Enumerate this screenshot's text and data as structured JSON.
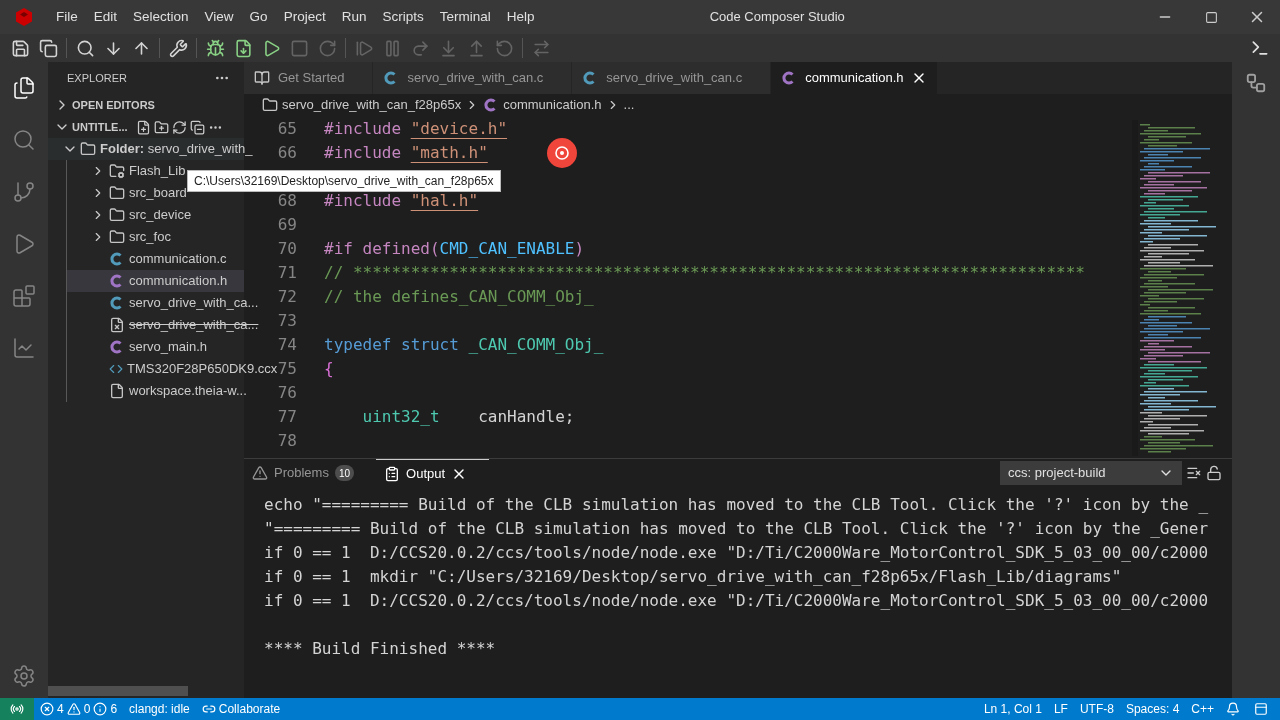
{
  "window": {
    "title": "Code Composer Studio"
  },
  "menu": [
    "File",
    "Edit",
    "Selection",
    "View",
    "Go",
    "Project",
    "Run",
    "Scripts",
    "Terminal",
    "Help"
  ],
  "toolbar": [
    {
      "kind": "save",
      "disabled": false
    },
    {
      "kind": "save-all",
      "disabled": false
    },
    {
      "kind": "sep"
    },
    {
      "kind": "search",
      "disabled": false
    },
    {
      "kind": "down",
      "disabled": false
    },
    {
      "kind": "up",
      "disabled": false
    },
    {
      "kind": "sep"
    },
    {
      "kind": "tools",
      "disabled": false
    },
    {
      "kind": "sep"
    },
    {
      "kind": "debug",
      "disabled": false
    },
    {
      "kind": "flash",
      "disabled": false
    },
    {
      "kind": "debug-run",
      "disabled": false
    },
    {
      "kind": "stop",
      "disabled": true
    },
    {
      "kind": "reload",
      "disabled": true
    },
    {
      "kind": "sep"
    },
    {
      "kind": "resume",
      "disabled": true
    },
    {
      "kind": "pause",
      "disabled": true
    },
    {
      "kind": "step-over",
      "disabled": true
    },
    {
      "kind": "step-into",
      "disabled": true
    },
    {
      "kind": "step-out",
      "disabled": true
    },
    {
      "kind": "restart",
      "disabled": true
    },
    {
      "kind": "sep"
    },
    {
      "kind": "connect",
      "disabled": true
    }
  ],
  "activity_bar": [
    {
      "kind": "explorer",
      "selected": true
    },
    {
      "kind": "search",
      "selected": false
    },
    {
      "kind": "source-control",
      "selected": false
    },
    {
      "kind": "run-debug",
      "selected": false
    },
    {
      "kind": "extensions",
      "selected": false
    },
    {
      "kind": "chart",
      "selected": false
    }
  ],
  "sidebar": {
    "title": "EXPLORER",
    "sections": [
      {
        "label": "OPEN EDITORS",
        "expanded": false
      },
      {
        "label": "UNTITLE...",
        "expanded": true
      }
    ],
    "root": {
      "label": "**Folder:** servo_drive_with_",
      "expanded": true,
      "children": [
        {
          "kind": "folder-gear",
          "label": "Flash_Lib",
          "expanded": false,
          "selected": false,
          "struck": false
        },
        {
          "kind": "folder",
          "label": "src_board",
          "expanded": false,
          "selected": false,
          "struck": false
        },
        {
          "kind": "folder",
          "label": "src_device",
          "expanded": false,
          "selected": false,
          "struck": false
        },
        {
          "kind": "folder",
          "label": "src_foc",
          "expanded": false,
          "selected": false,
          "struck": false
        },
        {
          "kind": "c",
          "label": "communication.c",
          "selected": false,
          "struck": false
        },
        {
          "kind": "h",
          "label": "communication.h",
          "selected": true,
          "struck": false
        },
        {
          "kind": "c",
          "label": "servo_drive_with_ca...",
          "selected": false,
          "struck": false
        },
        {
          "kind": "file-off",
          "label": "servo_drive_with_ca...",
          "selected": false,
          "struck": true
        },
        {
          "kind": "h",
          "label": "servo_main.h",
          "selected": false,
          "struck": false
        },
        {
          "kind": "xml",
          "label": "TMS320F28P650DK9.ccx",
          "selected": false,
          "struck": false
        },
        {
          "kind": "file",
          "label": "workspace.theia-w...",
          "selected": false,
          "struck": false
        }
      ]
    }
  },
  "tooltip": "C:\\Users\\32169\\Desktop\\servo_drive_with_can_f28p65x",
  "editor_tabs": [
    {
      "kind": "book",
      "label": "Get Started",
      "selected": false
    },
    {
      "kind": "c",
      "label": "servo_drive_with_can.c",
      "selected": false
    },
    {
      "kind": "c",
      "label": "servo_drive_with_can.c",
      "selected": false
    },
    {
      "kind": "h",
      "label": "communication.h",
      "selected": true
    }
  ],
  "breadcrumbs": [
    {
      "kind": "folder",
      "label": "servo_drive_with_can_f28p65x"
    },
    {
      "kind": "h",
      "label": "communication.h"
    },
    {
      "kind": "more",
      "label": "..."
    }
  ],
  "code_lines": [
    {
      "number": "65",
      "tokens": [
        {
          "kind": "directive",
          "text": "#include "
        },
        {
          "kind": "path",
          "text": "\"device.h\""
        }
      ]
    },
    {
      "number": "66",
      "tokens": [
        {
          "kind": "directive",
          "text": "#include "
        },
        {
          "kind": "path",
          "text": "\"math.h\""
        }
      ]
    },
    {
      "covered": true
    },
    {
      "number": "68",
      "tokens": [
        {
          "kind": "directive",
          "text": "#include "
        },
        {
          "kind": "path",
          "text": "\"hal.h\""
        }
      ]
    },
    {
      "number": "69"
    },
    {
      "number": "70",
      "tokens": [
        {
          "kind": "directive",
          "text": "#if defined("
        },
        {
          "kind": "macro",
          "text": "CMD_CAN_ENABLE"
        },
        {
          "kind": "directive",
          "text": ")"
        }
      ]
    },
    {
      "number": "71",
      "tokens": [
        {
          "kind": "comment",
          "text": "// ****************************************************************************"
        }
      ]
    },
    {
      "number": "72",
      "tokens": [
        {
          "kind": "comment",
          "text": "// the defines_CAN_COMM_Obj_"
        }
      ]
    },
    {
      "number": "73"
    },
    {
      "number": "74",
      "tokens": [
        {
          "kind": "keyword",
          "text": "typedef struct "
        },
        {
          "kind": "type",
          "text": "_CAN_COMM_Obj_"
        }
      ]
    },
    {
      "number": "75",
      "tokens": [
        {
          "kind": "bracket",
          "text": "{"
        }
      ]
    },
    {
      "number": "76"
    },
    {
      "number": "77",
      "tokens": [
        {
          "kind": "type",
          "text": "    uint32_t"
        },
        {
          "kind": "plain",
          "text": "    canHandle;"
        }
      ]
    },
    {
      "number": "78"
    }
  ],
  "panel": {
    "tabs": [
      {
        "kind": "problems",
        "label": "Problems",
        "badge": "10",
        "selected": false
      },
      {
        "kind": "output",
        "label": "Output",
        "selected": true
      }
    ],
    "channel": "ccs: project-build",
    "output": [
      "echo \"========= Build of the CLB simulation has moved to the CLB Tool. Click the '?' icon by the _",
      "\"========= Build of the CLB simulation has moved to the CLB Tool. Click the '?' icon by the _Gener",
      "if 0 == 1  D:/CCS20.0.2/ccs/tools/node/node.exe \"D:/Ti/C2000Ware_MotorControl_SDK_5_03_00_00/c2000",
      "if 0 == 1  mkdir \"C:/Users/32169/Desktop/servo_drive_with_can_f28p65x/Flash_Lib/diagrams\"",
      "if 0 == 1  D:/CCS20.0.2/ccs/tools/node/node.exe \"D:/Ti/C2000Ware_MotorControl_SDK_5_03_00_00/c2000"
    ],
    "summary": "**** Build Finished ****"
  },
  "status_bar": {
    "errors": "4",
    "warnings": "0",
    "infos": "6",
    "left": [
      {
        "kind": "text",
        "label": "clangd: idle"
      },
      {
        "kind": "collab",
        "label": "Collaborate"
      }
    ],
    "right": [
      "Ln 1, Col 1",
      "LF",
      "UTF-8",
      "Spaces: 4",
      "C++"
    ]
  }
}
